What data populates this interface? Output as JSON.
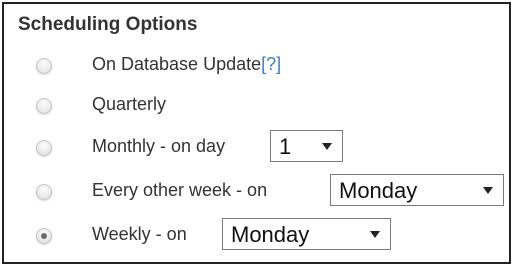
{
  "panel": {
    "title": "Scheduling Options"
  },
  "options": [
    {
      "label": "On Database Update",
      "help": "[?]",
      "checked": false
    },
    {
      "label": "Quarterly",
      "checked": false
    },
    {
      "label": "Monthly - on day",
      "select_value": "1",
      "checked": false
    },
    {
      "label": "Every other week - on",
      "select_value": "Monday",
      "checked": false
    },
    {
      "label": "Weekly - on",
      "select_value": "Monday",
      "checked": true
    }
  ],
  "colors": {
    "link": "#3b7fc4",
    "text": "#333333",
    "border": "#222222"
  },
  "icons": {
    "dropdown": "chevron-down-icon"
  }
}
